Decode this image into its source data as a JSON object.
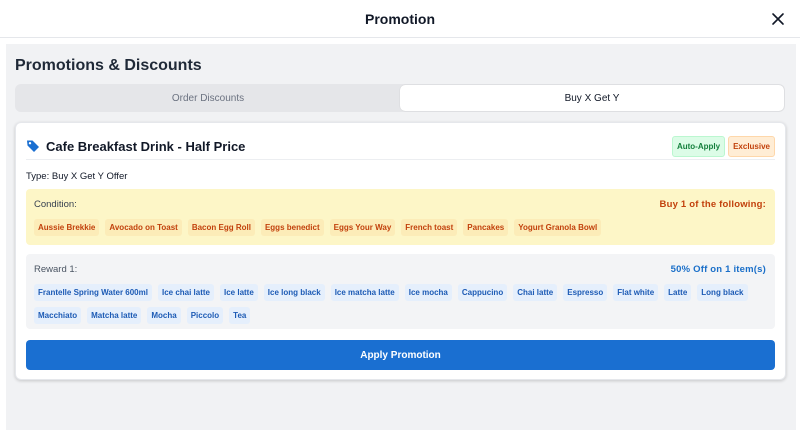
{
  "header": {
    "title": "Promotion",
    "close_icon": "close-icon"
  },
  "main": {
    "heading": "Promotions & Discounts",
    "tabs": [
      {
        "label": "Order Discounts",
        "active": false
      },
      {
        "label": "Buy X Get Y",
        "active": true
      }
    ]
  },
  "promotion": {
    "icon": "tag-icon",
    "name": "Cafe Breakfast Drink - Half Price",
    "badges": {
      "auto": "Auto-Apply",
      "exclusive": "Exclusive"
    },
    "type": "Type: Buy X Get Y Offer",
    "condition": {
      "label": "Condition:",
      "rule": "Buy 1 of the following:",
      "items": [
        "Aussie Brekkie",
        "Avocado on Toast",
        "Bacon Egg Roll",
        "Eggs benedict",
        "Eggs Your Way",
        "French toast",
        "Pancakes",
        "Yogurt Granola Bowl"
      ]
    },
    "reward": {
      "label": "Reward 1:",
      "rule": "50% Off on 1 item(s)",
      "items": [
        "Frantelle Spring Water 600ml",
        "Ice chai latte",
        "Ice latte",
        "Ice long black",
        "Ice matcha latte",
        "Ice mocha",
        "Cappucino",
        "Chai latte",
        "Espresso",
        "Flat white",
        "Latte",
        "Long black",
        "Macchiato",
        "Matcha latte",
        "Mocha",
        "Piccolo",
        "Tea"
      ]
    },
    "apply_label": "Apply Promotion"
  },
  "colors": {
    "accent": "#1a6fd1",
    "condition_bg": "#fdf6c7",
    "condition_text": "#c2410c",
    "reward_text": "#1d5bb5"
  }
}
